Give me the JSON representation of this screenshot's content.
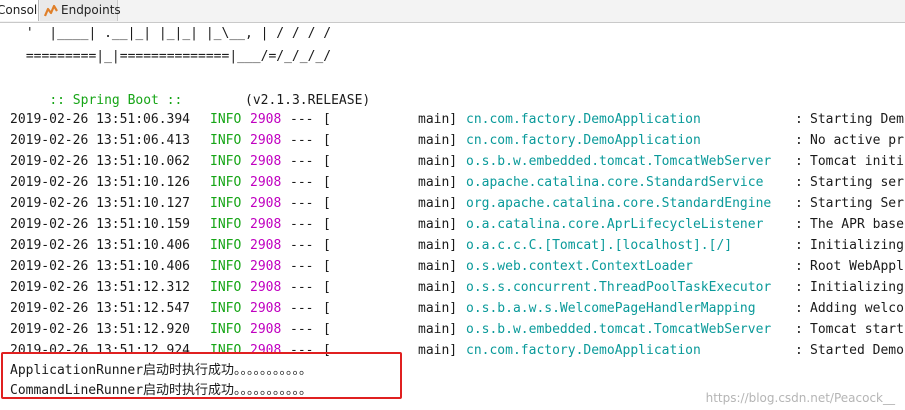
{
  "tabs": [
    {
      "label": "Console"
    },
    {
      "label": "Endpoints",
      "icon": "endpoints-icon"
    }
  ],
  "banner": {
    "ascii_lines": [
      " '  |____| .__|_| |_|_| |_\\__, | / / / /",
      " =========|_|==============|___/=/_/_/_/"
    ],
    "boot_label": ":: Spring Boot ::",
    "boot_version": "(v2.1.3.RELEASE)"
  },
  "log": [
    {
      "ts": "2019-02-26 13:51:06.394",
      "level": "INFO",
      "pid": "2908",
      "sep": "---",
      "thread": "main]",
      "logger": "cn.com.factory.DemoApplication",
      "msg": "Starting Dem"
    },
    {
      "ts": "2019-02-26 13:51:06.413",
      "level": "INFO",
      "pid": "2908",
      "sep": "---",
      "thread": "main]",
      "logger": "cn.com.factory.DemoApplication",
      "msg": "No active pr"
    },
    {
      "ts": "2019-02-26 13:51:10.062",
      "level": "INFO",
      "pid": "2908",
      "sep": "---",
      "thread": "main]",
      "logger": "o.s.b.w.embedded.tomcat.TomcatWebServer",
      "msg": "Tomcat initi"
    },
    {
      "ts": "2019-02-26 13:51:10.126",
      "level": "INFO",
      "pid": "2908",
      "sep": "---",
      "thread": "main]",
      "logger": "o.apache.catalina.core.StandardService",
      "msg": "Starting ser"
    },
    {
      "ts": "2019-02-26 13:51:10.127",
      "level": "INFO",
      "pid": "2908",
      "sep": "---",
      "thread": "main]",
      "logger": "org.apache.catalina.core.StandardEngine",
      "msg": "Starting Ser"
    },
    {
      "ts": "2019-02-26 13:51:10.159",
      "level": "INFO",
      "pid": "2908",
      "sep": "---",
      "thread": "main]",
      "logger": "o.a.catalina.core.AprLifecycleListener",
      "msg": "The APR base"
    },
    {
      "ts": "2019-02-26 13:51:10.406",
      "level": "INFO",
      "pid": "2908",
      "sep": "---",
      "thread": "main]",
      "logger": "o.a.c.c.C.[Tomcat].[localhost].[/]",
      "msg": "Initializing"
    },
    {
      "ts": "2019-02-26 13:51:10.406",
      "level": "INFO",
      "pid": "2908",
      "sep": "---",
      "thread": "main]",
      "logger": "o.s.web.context.ContextLoader",
      "msg": "Root WebAppl"
    },
    {
      "ts": "2019-02-26 13:51:12.312",
      "level": "INFO",
      "pid": "2908",
      "sep": "---",
      "thread": "main]",
      "logger": "o.s.s.concurrent.ThreadPoolTaskExecutor",
      "msg": "Initializing"
    },
    {
      "ts": "2019-02-26 13:51:12.547",
      "level": "INFO",
      "pid": "2908",
      "sep": "---",
      "thread": "main]",
      "logger": "o.s.b.a.w.s.WelcomePageHandlerMapping",
      "msg": "Adding welco"
    },
    {
      "ts": "2019-02-26 13:51:12.920",
      "level": "INFO",
      "pid": "2908",
      "sep": "---",
      "thread": "main]",
      "logger": "o.s.b.w.embedded.tomcat.TomcatWebServer",
      "msg": "Tomcat start"
    },
    {
      "ts": "2019-02-26 13:51:12.924",
      "level": "INFO",
      "pid": "2908",
      "sep": "---",
      "thread": "main]",
      "logger": "cn.com.factory.DemoApplication",
      "msg": "Started Demo"
    }
  ],
  "custom_lines": [
    "ApplicationRunner启动时执行成功。。。。。。。。。。。",
    "CommandLineRunner启动时执行成功。。。。。。。。。。。"
  ],
  "watermark": "https://blog.csdn.net/Peacock__",
  "colors": {
    "info": "#16a516",
    "pid": "#c000c0",
    "logger": "#0a9a9a",
    "highlight": "#e02020"
  }
}
